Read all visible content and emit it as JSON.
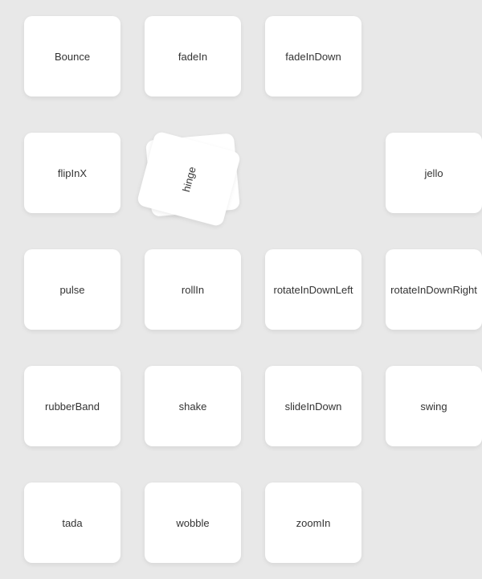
{
  "cards": {
    "row1": [
      {
        "id": "bounce",
        "label": "Bounce",
        "col": 1
      },
      {
        "id": "fadeIn",
        "label": "fadeIn",
        "col": 2
      },
      {
        "id": "fadeInDown",
        "label": "fadeInDown",
        "col": 3
      }
    ],
    "row2": [
      {
        "id": "flipInX",
        "label": "flipInX",
        "col": 1
      },
      {
        "id": "hinge",
        "label": "hinge",
        "col": 2
      },
      {
        "id": "jello",
        "label": "jello",
        "col": 4
      }
    ],
    "row3": [
      {
        "id": "pulse",
        "label": "pulse",
        "col": 1
      },
      {
        "id": "rollIn",
        "label": "rollIn",
        "col": 2
      },
      {
        "id": "rotateInDownLeft",
        "label": "rotateInDownLeft",
        "col": 3
      },
      {
        "id": "rotateInDownRight",
        "label": "rotateInDownRight",
        "col": 4
      }
    ],
    "row4": [
      {
        "id": "rubberBand",
        "label": "rubberBand",
        "col": 1
      },
      {
        "id": "shake",
        "label": "shake",
        "col": 2
      },
      {
        "id": "slideInDown",
        "label": "slideInDown",
        "col": 3
      },
      {
        "id": "swing",
        "label": "swing",
        "col": 4
      }
    ],
    "row5": [
      {
        "id": "tada",
        "label": "tada",
        "col": 1
      },
      {
        "id": "wobble",
        "label": "wobble",
        "col": 2
      },
      {
        "id": "zoomIn",
        "label": "zoomIn",
        "col": 3
      }
    ]
  },
  "background_color": "#e8e8e8"
}
